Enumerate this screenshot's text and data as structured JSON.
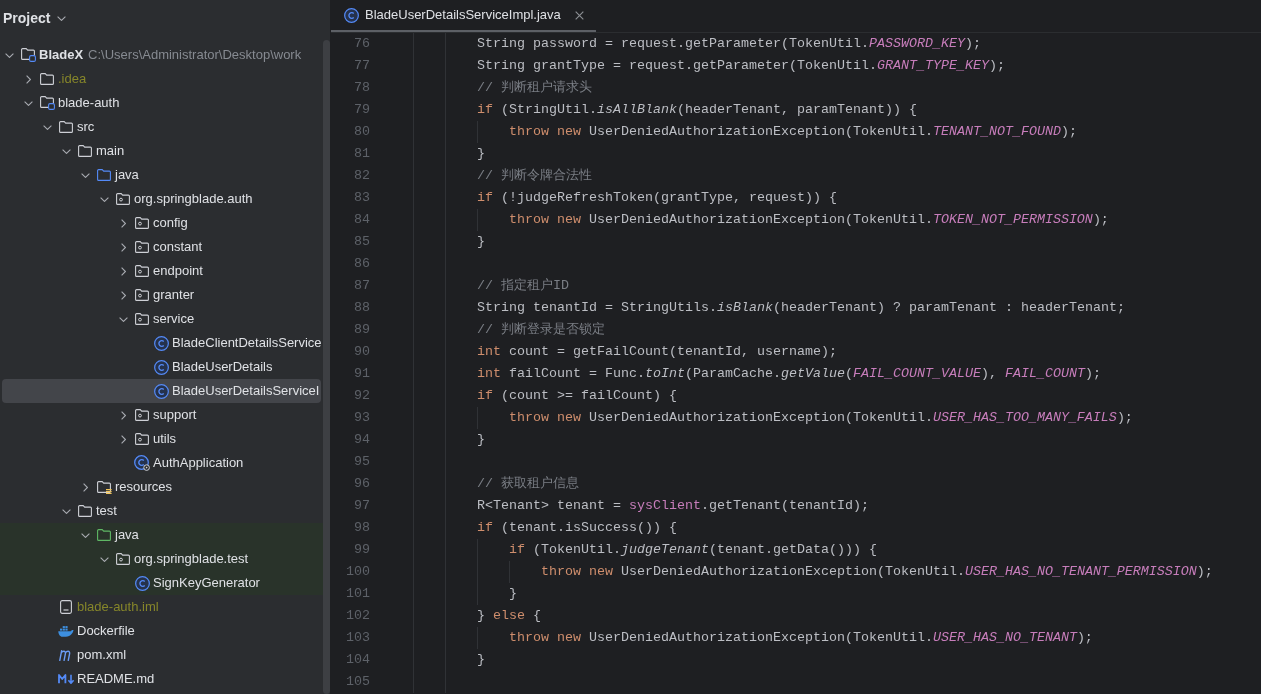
{
  "project_panel": {
    "title": "Project",
    "tree": [
      {
        "label": "BladeX",
        "path": "C:\\Users\\Administrator\\Desktop\\work",
        "kind": "module",
        "expanded": true,
        "selected": false,
        "children": [
          {
            "label": ".idea",
            "kind": "folder",
            "expanded": false,
            "selected": false,
            "color": "#86862a"
          },
          {
            "label": "blade-auth",
            "kind": "module",
            "expanded": true,
            "selected": false,
            "children": [
              {
                "label": "src",
                "kind": "folder",
                "expanded": true,
                "selected": false,
                "children": [
                  {
                    "label": "main",
                    "kind": "folder",
                    "expanded": true,
                    "selected": false,
                    "children": [
                      {
                        "label": "java",
                        "kind": "source_root",
                        "expanded": true,
                        "selected": false,
                        "children": [
                          {
                            "label": "org.springblade.auth",
                            "kind": "package",
                            "expanded": true,
                            "selected": false,
                            "children": [
                              {
                                "label": "config",
                                "kind": "package",
                                "expanded": false,
                                "selected": false
                              },
                              {
                                "label": "constant",
                                "kind": "package",
                                "expanded": false,
                                "selected": false
                              },
                              {
                                "label": "endpoint",
                                "kind": "package",
                                "expanded": false,
                                "selected": false
                              },
                              {
                                "label": "granter",
                                "kind": "package",
                                "expanded": false,
                                "selected": false
                              },
                              {
                                "label": "service",
                                "kind": "package",
                                "expanded": true,
                                "selected": false,
                                "children": [
                                  {
                                    "label": "BladeClientDetailsService",
                                    "kind": "class",
                                    "selected": false
                                  },
                                  {
                                    "label": "BladeUserDetails",
                                    "kind": "class",
                                    "selected": false
                                  },
                                  {
                                    "label": "BladeUserDetailsServiceI",
                                    "kind": "class",
                                    "selected": true
                                  }
                                ]
                              },
                              {
                                "label": "support",
                                "kind": "package",
                                "expanded": false,
                                "selected": false
                              },
                              {
                                "label": "utils",
                                "kind": "package",
                                "expanded": false,
                                "selected": false
                              },
                              {
                                "label": "AuthApplication",
                                "kind": "app_class",
                                "selected": false
                              }
                            ]
                          }
                        ]
                      },
                      {
                        "label": "resources",
                        "kind": "resources_root",
                        "expanded": false,
                        "selected": false
                      }
                    ]
                  },
                  {
                    "label": "test",
                    "kind": "folder",
                    "expanded": true,
                    "selected": false,
                    "children": [
                      {
                        "label": "java",
                        "kind": "test_root",
                        "expanded": true,
                        "selected": false,
                        "children": [
                          {
                            "label": "org.springblade.test",
                            "kind": "package",
                            "expanded": true,
                            "selected": false,
                            "children": [
                              {
                                "label": "SignKeyGenerator",
                                "kind": "class",
                                "selected": false
                              }
                            ]
                          }
                        ]
                      }
                    ]
                  }
                ]
              },
              {
                "label": "blade-auth.iml",
                "kind": "iml_file",
                "selected": false,
                "color": "#86862a"
              },
              {
                "label": "Dockerfile",
                "kind": "docker_file",
                "selected": false
              },
              {
                "label": "pom.xml",
                "kind": "maven_file",
                "selected": false
              },
              {
                "label": "README.md",
                "kind": "markdown_file",
                "selected": false
              }
            ]
          }
        ]
      }
    ]
  },
  "editor": {
    "tabs": [
      {
        "label": "BladeUserDetailsServiceImpl.java",
        "selected": true
      }
    ],
    "lines": [
      {
        "number": "76",
        "tokens": [
          {
            "kind": "plain",
            "text": "String password = request.getParameter(TokenUtil."
          },
          {
            "kind": "constant",
            "text": "PASSWORD_KEY"
          },
          {
            "kind": "plain",
            "text": ");"
          }
        ]
      },
      {
        "number": "77",
        "tokens": [
          {
            "kind": "plain",
            "text": "String grantType = request.getParameter(TokenUtil."
          },
          {
            "kind": "constant",
            "text": "GRANT_TYPE_KEY"
          },
          {
            "kind": "plain",
            "text": ");"
          }
        ]
      },
      {
        "number": "78",
        "tokens": [
          {
            "kind": "comment",
            "text": "// 判断租户请求头"
          }
        ]
      },
      {
        "number": "79",
        "tokens": [
          {
            "kind": "keyword",
            "text": "if"
          },
          {
            "kind": "plain",
            "text": " (StringUtil."
          },
          {
            "kind": "static_method",
            "text": "isAllBlank"
          },
          {
            "kind": "plain",
            "text": "(headerTenant, paramTenant)) {"
          }
        ],
        "children": [
          {
            "number": "80",
            "tokens": [
              {
                "kind": "keyword",
                "text": "throw new"
              },
              {
                "kind": "plain",
                "text": " UserDeniedAuthorizationException(TokenUtil."
              },
              {
                "kind": "constant",
                "text": "TENANT_NOT_FOUND"
              },
              {
                "kind": "plain",
                "text": ");"
              }
            ]
          }
        ]
      },
      {
        "number": "81",
        "tokens": [
          {
            "kind": "plain",
            "text": "}"
          }
        ]
      },
      {
        "number": "82",
        "tokens": [
          {
            "kind": "comment",
            "text": "// 判断令牌合法性"
          }
        ]
      },
      {
        "number": "83",
        "tokens": [
          {
            "kind": "keyword",
            "text": "if"
          },
          {
            "kind": "plain",
            "text": " (!judgeRefreshToken(grantType, request)) {"
          }
        ],
        "children": [
          {
            "number": "84",
            "tokens": [
              {
                "kind": "keyword",
                "text": "throw new"
              },
              {
                "kind": "plain",
                "text": " UserDeniedAuthorizationException(TokenUtil."
              },
              {
                "kind": "constant",
                "text": "TOKEN_NOT_PERMISSION"
              },
              {
                "kind": "plain",
                "text": ");"
              }
            ]
          }
        ]
      },
      {
        "number": "85",
        "tokens": [
          {
            "kind": "plain",
            "text": "}"
          }
        ]
      },
      {
        "number": "86"
      },
      {
        "number": "87",
        "tokens": [
          {
            "kind": "comment",
            "text": "// 指定租户ID"
          }
        ]
      },
      {
        "number": "88",
        "tokens": [
          {
            "kind": "plain",
            "text": "String tenantId = StringUtils."
          },
          {
            "kind": "static_method",
            "text": "isBlank"
          },
          {
            "kind": "plain",
            "text": "(headerTenant) ? paramTenant : headerTenant;"
          }
        ]
      },
      {
        "number": "89",
        "tokens": [
          {
            "kind": "comment",
            "text": "// 判断登录是否锁定"
          }
        ]
      },
      {
        "number": "90",
        "tokens": [
          {
            "kind": "keyword",
            "text": "int"
          },
          {
            "kind": "plain",
            "text": " count = getFailCount(tenantId, username);"
          }
        ]
      },
      {
        "number": "91",
        "tokens": [
          {
            "kind": "keyword",
            "text": "int"
          },
          {
            "kind": "plain",
            "text": " failCount = Func."
          },
          {
            "kind": "static_method",
            "text": "toInt"
          },
          {
            "kind": "plain",
            "text": "(ParamCache."
          },
          {
            "kind": "static_method",
            "text": "getValue"
          },
          {
            "kind": "plain",
            "text": "("
          },
          {
            "kind": "constant",
            "text": "FAIL_COUNT_VALUE"
          },
          {
            "kind": "plain",
            "text": "), "
          },
          {
            "kind": "constant",
            "text": "FAIL_COUNT"
          },
          {
            "kind": "plain",
            "text": ");"
          }
        ]
      },
      {
        "number": "92",
        "tokens": [
          {
            "kind": "keyword",
            "text": "if"
          },
          {
            "kind": "plain",
            "text": " (count >= failCount) {"
          }
        ],
        "children": [
          {
            "number": "93",
            "tokens": [
              {
                "kind": "keyword",
                "text": "throw new"
              },
              {
                "kind": "plain",
                "text": " UserDeniedAuthorizationException(TokenUtil."
              },
              {
                "kind": "constant",
                "text": "USER_HAS_TOO_MANY_FAILS"
              },
              {
                "kind": "plain",
                "text": ");"
              }
            ]
          }
        ]
      },
      {
        "number": "94",
        "tokens": [
          {
            "kind": "plain",
            "text": "}"
          }
        ]
      },
      {
        "number": "95"
      },
      {
        "number": "96",
        "tokens": [
          {
            "kind": "comment",
            "text": "// 获取租户信息"
          }
        ]
      },
      {
        "number": "97",
        "tokens": [
          {
            "kind": "plain",
            "text": "R<Tenant> tenant = "
          },
          {
            "kind": "field",
            "text": "sysClient"
          },
          {
            "kind": "plain",
            "text": ".getTenant(tenantId);"
          }
        ]
      },
      {
        "number": "98",
        "tokens": [
          {
            "kind": "keyword",
            "text": "if"
          },
          {
            "kind": "plain",
            "text": " (tenant.isSuccess()) {"
          }
        ],
        "children": [
          {
            "number": "99",
            "tokens": [
              {
                "kind": "keyword",
                "text": "if"
              },
              {
                "kind": "plain",
                "text": " (TokenUtil."
              },
              {
                "kind": "static_method",
                "text": "judgeTenant"
              },
              {
                "kind": "plain",
                "text": "(tenant.getData())) {"
              }
            ],
            "children": [
              {
                "number": "100",
                "tokens": [
                  {
                    "kind": "keyword",
                    "text": "throw new"
                  },
                  {
                    "kind": "plain",
                    "text": " UserDeniedAuthorizationException(TokenUtil."
                  },
                  {
                    "kind": "constant",
                    "text": "USER_HAS_NO_TENANT_PERMISSION"
                  },
                  {
                    "kind": "plain",
                    "text": ");"
                  }
                ]
              }
            ]
          },
          {
            "number": "101",
            "tokens": [
              {
                "kind": "plain",
                "text": "}"
              }
            ]
          }
        ]
      },
      {
        "number": "102",
        "tokens": [
          {
            "kind": "plain",
            "text": "} "
          },
          {
            "kind": "keyword",
            "text": "else"
          },
          {
            "kind": "plain",
            "text": " {"
          }
        ],
        "children": [
          {
            "number": "103",
            "tokens": [
              {
                "kind": "keyword",
                "text": "throw new"
              },
              {
                "kind": "plain",
                "text": " UserDeniedAuthorizationException(TokenUtil."
              },
              {
                "kind": "constant",
                "text": "USER_HAS_NO_TENANT"
              },
              {
                "kind": "plain",
                "text": ");"
              }
            ]
          }
        ]
      },
      {
        "number": "104",
        "tokens": [
          {
            "kind": "plain",
            "text": "}"
          }
        ]
      },
      {
        "number": "105"
      }
    ]
  }
}
